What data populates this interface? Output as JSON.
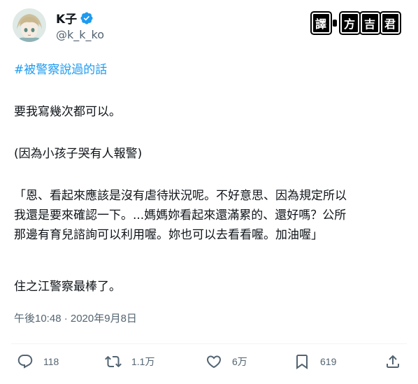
{
  "user": {
    "display_name": "K子",
    "handle": "@k_k_ko",
    "verified_icon": "verified-badge-icon",
    "avatar": "anime-girl-avatar"
  },
  "watermark": {
    "c1": "譯",
    "c2": "方",
    "c3": "吉",
    "c4": "君"
  },
  "tweet": {
    "hashtag": "#被警察說過的話",
    "line1": "要我寫幾次都可以。",
    "line2": "(因為小孩子哭有人報警)",
    "quote1": "「恩、看起來應該是沒有虐待狀況呢。不好意思、因為規定所以",
    "quote2": "我還是要來確認一下。...媽媽妳看起來還滿累的、還好嗎？公所",
    "quote3": "那邊有育兒諮詢可以利用喔。妳也可以去看看喔。加油喔」",
    "line3": "住之江警察最棒了。",
    "timestamp": "午後10:48 · 2020年9月8日"
  },
  "actions": {
    "reply": {
      "icon": "reply-bubble-icon",
      "count": "118"
    },
    "retweet": {
      "icon": "retweet-icon",
      "count": "1.1万"
    },
    "like": {
      "icon": "heart-icon",
      "count": "6万"
    },
    "bookmark": {
      "icon": "bookmark-icon",
      "count": "619"
    },
    "share": {
      "icon": "share-icon"
    }
  },
  "colors": {
    "text": "#0f1419",
    "secondary": "#536471",
    "link": "#1d9bf0",
    "verified": "#1d9bf0",
    "divider": "#eff3f4"
  }
}
